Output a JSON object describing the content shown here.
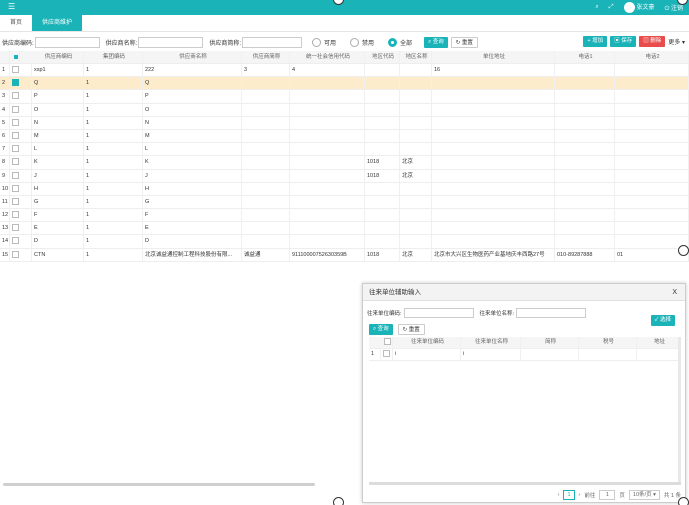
{
  "topbar": {
    "menu_icon": "menu-icon",
    "user_name": "张文豪",
    "logout": "注销"
  },
  "tabs": [
    {
      "label": "首页"
    },
    {
      "label": "供应商维护"
    }
  ],
  "filter": {
    "code_label": "供应商编码:",
    "name_label": "供应商名称:",
    "short_label": "供应商简称:",
    "radio_available": "可用",
    "radio_disabled": "禁用",
    "radio_all": "全部",
    "query": "查询",
    "reset": "重置"
  },
  "toolbar": {
    "add": "增加",
    "save": "保存",
    "delete": "删除",
    "more": "更多"
  },
  "grid": {
    "headers": [
      "供应商编码",
      "集团编码",
      "供应商名称",
      "供应商简称",
      "统一社会信用代码",
      "地区代码",
      "地区名称",
      "单位地址",
      "电话1",
      "电话2"
    ],
    "rows": [
      [
        "1",
        "xsp1",
        "1",
        "222",
        "3",
        "4",
        "",
        "",
        "16",
        "",
        ""
      ],
      [
        "2",
        "Q",
        "1",
        "Q",
        "",
        "",
        "",
        "",
        "",
        "",
        ""
      ],
      [
        "3",
        "P",
        "1",
        "P",
        "",
        "",
        "",
        "",
        "",
        "",
        ""
      ],
      [
        "4",
        "O",
        "1",
        "O",
        "",
        "",
        "",
        "",
        "",
        "",
        ""
      ],
      [
        "5",
        "N",
        "1",
        "N",
        "",
        "",
        "",
        "",
        "",
        "",
        ""
      ],
      [
        "6",
        "M",
        "1",
        "M",
        "",
        "",
        "",
        "",
        "",
        "",
        ""
      ],
      [
        "7",
        "L",
        "1",
        "L",
        "",
        "",
        "",
        "",
        "",
        "",
        ""
      ],
      [
        "8",
        "K",
        "1",
        "K",
        "",
        "",
        "1018",
        "北京",
        "",
        "",
        ""
      ],
      [
        "9",
        "J",
        "1",
        "J",
        "",
        "",
        "1018",
        "北京",
        "",
        "",
        ""
      ],
      [
        "10",
        "H",
        "1",
        "H",
        "",
        "",
        "",
        "",
        "",
        "",
        ""
      ],
      [
        "11",
        "G",
        "1",
        "G",
        "",
        "",
        "",
        "",
        "",
        "",
        ""
      ],
      [
        "12",
        "F",
        "1",
        "F",
        "",
        "",
        "",
        "",
        "",
        "",
        ""
      ],
      [
        "13",
        "E",
        "1",
        "E",
        "",
        "",
        "",
        "",
        "",
        "",
        ""
      ],
      [
        "14",
        "D",
        "1",
        "D",
        "",
        "",
        "",
        "",
        "",
        "",
        ""
      ],
      [
        "15",
        "CTN",
        "1",
        "北京诚益通控制工程科技股份有限...",
        "诚益通",
        "91110000752630359B",
        "1018",
        "北京",
        "北京市大兴区生物医药产业基地庆丰西路27号",
        "010-89287888",
        "01"
      ]
    ],
    "selected_row": 1
  },
  "dialog": {
    "title": "往来单位辅助输入",
    "close": "X",
    "code_label": "往来单位编码:",
    "name_label": "往来单位名称:",
    "query": "查询",
    "reset": "重置",
    "select": "选择",
    "headers": [
      "往来单位编码",
      "往来单位名称",
      "简称",
      "税号",
      "地址"
    ],
    "rows": [
      [
        "1",
        "i",
        "i",
        "",
        "",
        ""
      ]
    ],
    "pager": {
      "page": "1",
      "goto_label": "前往",
      "goto_value": "1",
      "unit": "页",
      "per_page": "10条/页",
      "total": "共 1 条"
    }
  }
}
